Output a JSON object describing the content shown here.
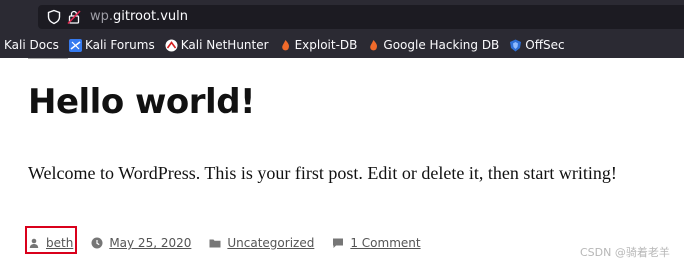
{
  "browser": {
    "address_bar": {
      "url_prefix": "wp.",
      "url_host": "gitroot.vuln"
    },
    "bookmarks": [
      {
        "label": "Kali Docs",
        "icon": "kali-icon"
      },
      {
        "label": "Kali Forums",
        "icon": "kali-forums-icon"
      },
      {
        "label": "Kali NetHunter",
        "icon": "nethunter-icon"
      },
      {
        "label": "Exploit-DB",
        "icon": "exploit-db-icon"
      },
      {
        "label": "Google Hacking DB",
        "icon": "ghdb-icon"
      },
      {
        "label": "OffSec",
        "icon": "offsec-icon"
      }
    ]
  },
  "post": {
    "title": "Hello world!",
    "body": "Welcome to WordPress. This is your first post. Edit or delete it, then start writing!",
    "meta": {
      "author": "beth",
      "date": "May 25, 2020",
      "category": "Uncategorized",
      "comments": "1 Comment"
    }
  },
  "colors": {
    "highlight_box": "#d9001b",
    "browser_chrome": "#2b2a33"
  },
  "watermark": "CSDN @骑着老羊"
}
